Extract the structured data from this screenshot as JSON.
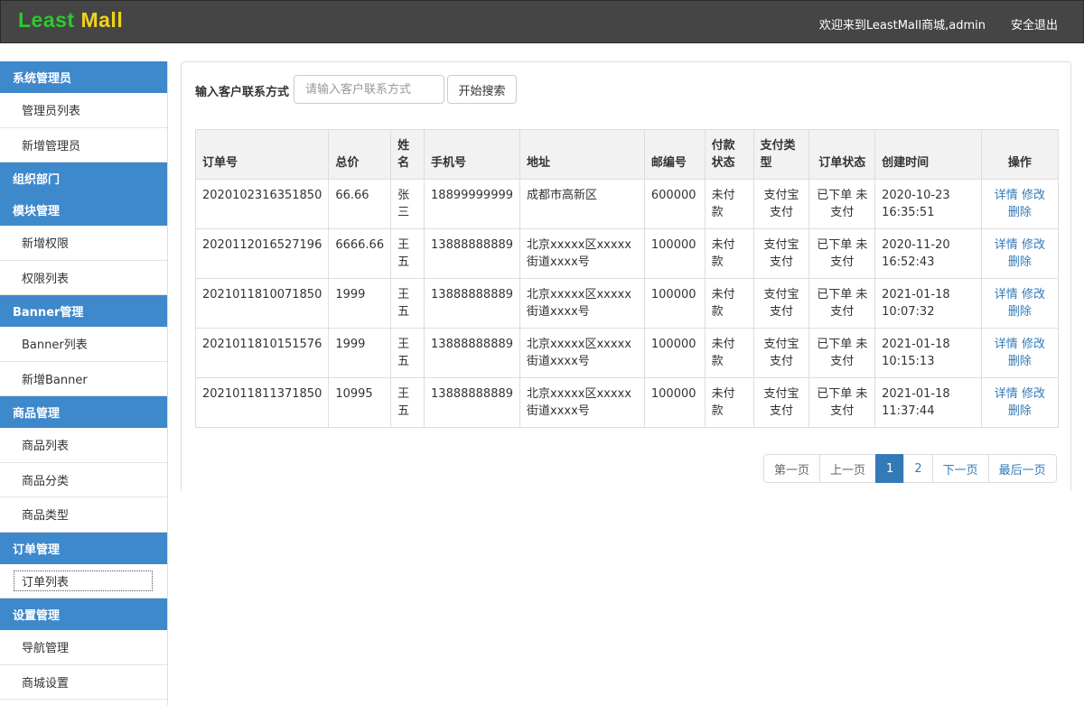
{
  "header": {
    "logo_least": "Least",
    "logo_mall": "Mall",
    "welcome": "欢迎来到LeastMall商城,admin",
    "logout": "安全退出"
  },
  "sidebar": {
    "groups": [
      {
        "title": "系统管理员",
        "items": [
          "管理员列表",
          "新增管理员"
        ]
      },
      {
        "title": "组织部门",
        "items": []
      },
      {
        "title": "模块管理",
        "items": [
          "新增权限",
          "权限列表"
        ]
      },
      {
        "title": "Banner管理",
        "items": [
          "Banner列表",
          "新增Banner"
        ]
      },
      {
        "title": "商品管理",
        "items": [
          "商品列表",
          "商品分类",
          "商品类型"
        ]
      },
      {
        "title": "订单管理",
        "items": [
          "订单列表"
        ]
      },
      {
        "title": "设置管理",
        "items": [
          "导航管理",
          "商城设置"
        ]
      }
    ],
    "active_item": "订单列表"
  },
  "search": {
    "label": "输入客户联系方式",
    "placeholder": "请输入客户联系方式",
    "button": "开始搜索"
  },
  "table": {
    "headers": [
      "订单号",
      "总价",
      "姓名",
      "手机号",
      "地址",
      "邮编号",
      "付款状态",
      "支付类型",
      "订单状态",
      "创建时间",
      "操作"
    ],
    "rows": [
      {
        "order_no": "2020102316351850",
        "total": "66.66",
        "name": "张三",
        "phone": "18899999999",
        "address": "成都市高新区",
        "zip": "600000",
        "pay_status": "未付款",
        "pay_type": "支付宝支付",
        "order_status": "已下单 未支付",
        "created": "2020-10-23 16:35:51"
      },
      {
        "order_no": "2020112016527196",
        "total": "6666.66",
        "name": "王五",
        "phone": "13888888889",
        "address": "北京xxxxx区xxxxx街道xxxx号",
        "zip": "100000",
        "pay_status": "未付款",
        "pay_type": "支付宝支付",
        "order_status": "已下单 未支付",
        "created": "2020-11-20 16:52:43"
      },
      {
        "order_no": "2021011810071850",
        "total": "1999",
        "name": "王五",
        "phone": "13888888889",
        "address": "北京xxxxx区xxxxx街道xxxx号",
        "zip": "100000",
        "pay_status": "未付款",
        "pay_type": "支付宝支付",
        "order_status": "已下单 未支付",
        "created": "2021-01-18 10:07:32"
      },
      {
        "order_no": "2021011810151576",
        "total": "1999",
        "name": "王五",
        "phone": "13888888889",
        "address": "北京xxxxx区xxxxx街道xxxx号",
        "zip": "100000",
        "pay_status": "未付款",
        "pay_type": "支付宝支付",
        "order_status": "已下单 未支付",
        "created": "2021-01-18 10:15:13"
      },
      {
        "order_no": "2021011811371850",
        "total": "10995",
        "name": "王五",
        "phone": "13888888889",
        "address": "北京xxxxx区xxxxx街道xxxx号",
        "zip": "100000",
        "pay_status": "未付款",
        "pay_type": "支付宝支付",
        "order_status": "已下单 未支付",
        "created": "2021-01-18 11:37:44"
      }
    ],
    "actions": {
      "detail": "详情",
      "edit": "修改",
      "delete": "删除"
    }
  },
  "pagination": {
    "first": "第一页",
    "prev": "上一页",
    "pages": [
      "1",
      "2"
    ],
    "current": "1",
    "next": "下一页",
    "last": "最后一页"
  },
  "colors": {
    "header_bg": "#454545",
    "sidebar_group_bg": "#3e88cc",
    "logo_least": "#2ec82e",
    "logo_mall": "#f0d21e",
    "link": "#337ab7"
  }
}
